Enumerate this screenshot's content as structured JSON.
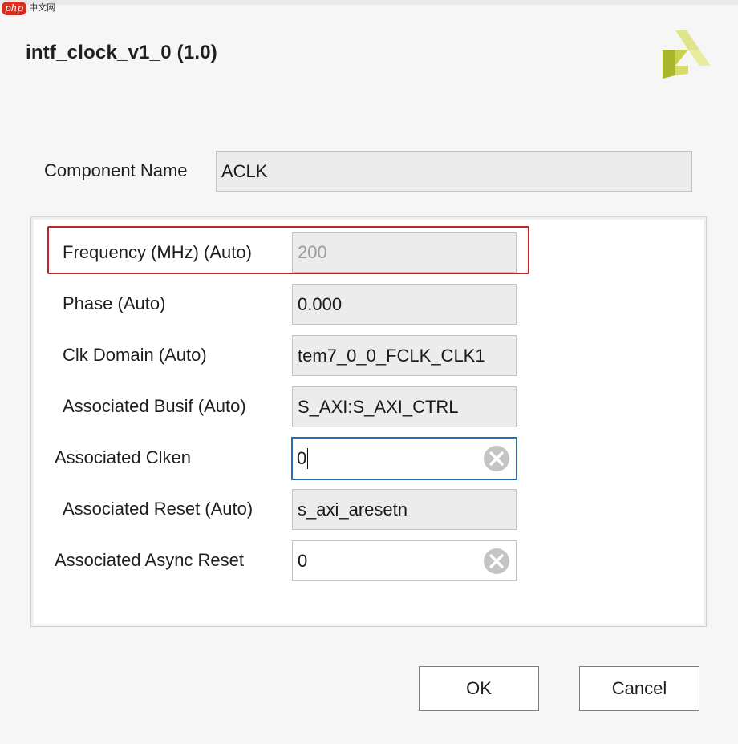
{
  "watermark": {
    "logo": "php",
    "text": "中文网"
  },
  "dialog": {
    "title": "intf_clock_v1_0 (1.0)"
  },
  "component": {
    "label": "Component Name",
    "value": "ACLK"
  },
  "params": [
    {
      "label": "Frequency (MHz) (Auto)",
      "value": "200"
    },
    {
      "label": "Phase (Auto)",
      "value": "0.000"
    },
    {
      "label": "Clk Domain (Auto)",
      "value": "tem7_0_0_FCLK_CLK1"
    },
    {
      "label": "Associated Busif (Auto)",
      "value": "S_AXI:S_AXI_CTRL"
    },
    {
      "label": "Associated Clken",
      "value": "0"
    },
    {
      "label": "Associated Reset (Auto)",
      "value": "s_axi_aresetn"
    },
    {
      "label": "Associated Async Reset",
      "value": "0"
    }
  ],
  "buttons": {
    "ok": "OK",
    "cancel": "Cancel"
  },
  "colors": {
    "highlight": "#c8202a",
    "focus": "#2a6fb5",
    "brand_light": "#d9e07a",
    "brand_dark": "#8f9a1e"
  },
  "icons": {
    "brand": "xilinx-logo-icon",
    "clear": "clear-circle-x-icon"
  }
}
